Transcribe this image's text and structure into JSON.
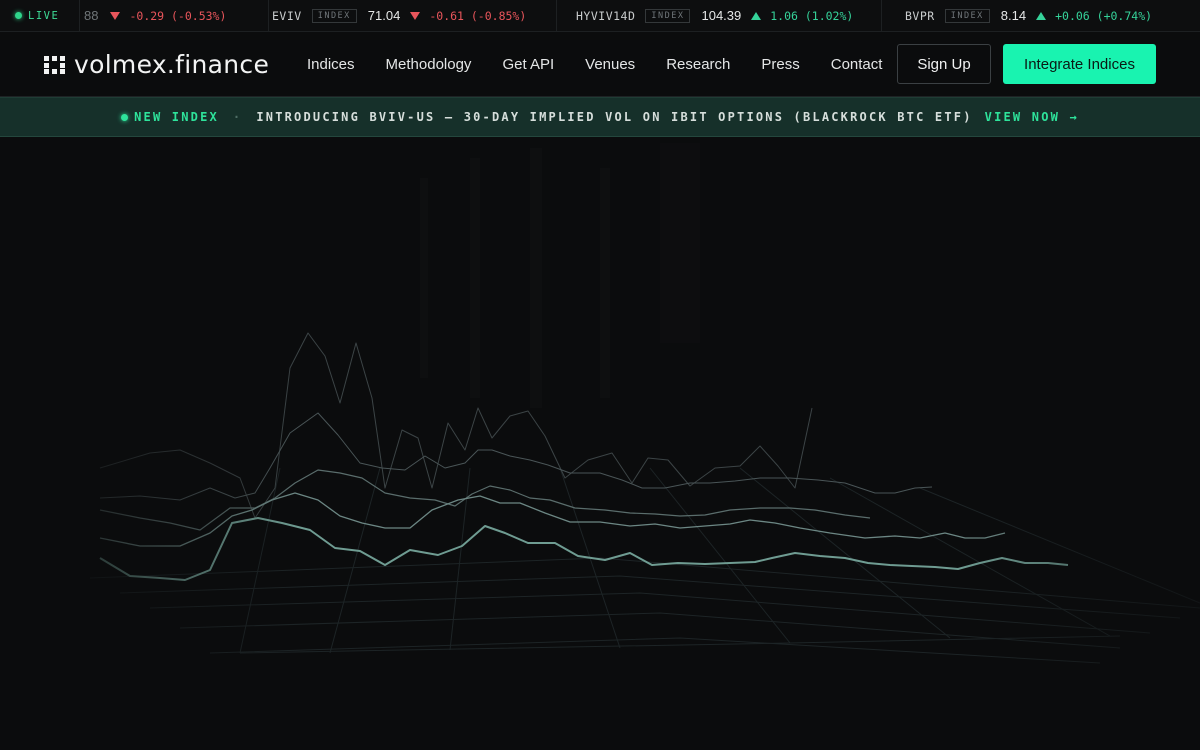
{
  "ticker": {
    "live_label": "LIVE",
    "items": [
      {
        "symbol": "",
        "badge": "",
        "value": "",
        "partial_value": "88",
        "change": "-0.29 (-0.53%)",
        "direction": "down"
      },
      {
        "symbol": "EVIV",
        "badge": "INDEX",
        "value": "71.04",
        "change": "-0.61 (-0.85%)",
        "direction": "down"
      },
      {
        "symbol": "HYVIV14D",
        "badge": "INDEX",
        "value": "104.39",
        "change": "1.06 (1.02%)",
        "direction": "up"
      },
      {
        "symbol": "BVPR",
        "badge": "INDEX",
        "value": "8.14",
        "change": "+0.06 (+0.74%)",
        "direction": "up"
      }
    ]
  },
  "nav": {
    "logo_text": "volmex.finance",
    "links": [
      "Indices",
      "Methodology",
      "Get API",
      "Venues",
      "Research",
      "Press",
      "Contact"
    ],
    "signup_label": "Sign Up",
    "integrate_label": "Integrate Indices"
  },
  "announcement": {
    "tag": "NEW INDEX",
    "separator": "·",
    "text": "INTRODUCING BVIV-US — 30-DAY IMPLIED VOL ON IBIT OPTIONS (BLACKROCK BTC ETF)",
    "link": "VIEW NOW →"
  },
  "colors": {
    "accent": "#19f3b0",
    "positive": "#35d39a",
    "negative": "#e8555b",
    "banner_bg": "#16302a"
  },
  "icons": {
    "live": "live-dot-icon",
    "down": "triangle-down-icon",
    "up": "triangle-up-icon",
    "arrow": "arrow-right-icon"
  }
}
